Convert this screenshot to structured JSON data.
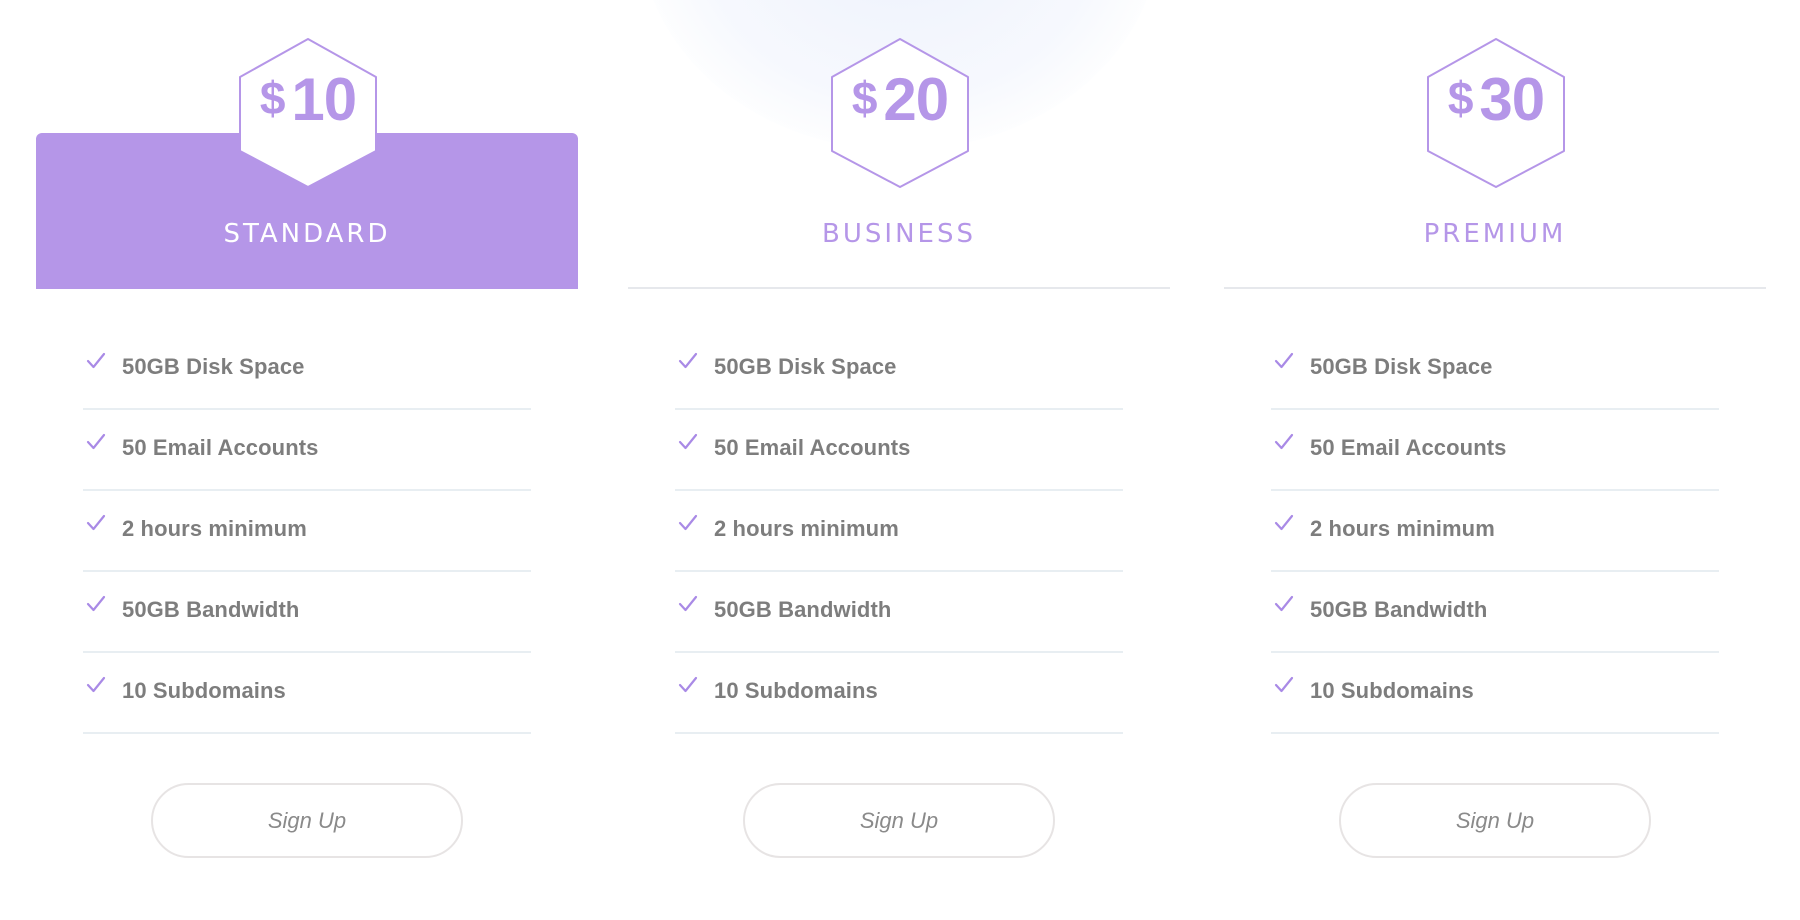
{
  "colors": {
    "accent": "#b596e8",
    "feature_text": "#7d7d7d",
    "divider": "#e8eef2",
    "button_border": "#e7e4e4"
  },
  "plans": [
    {
      "id": "standard",
      "featured": true,
      "currency": "$",
      "amount": "10",
      "name": "STANDARD",
      "features": [
        {
          "icon": "check-icon",
          "label": "50GB Disk Space"
        },
        {
          "icon": "check-icon",
          "label": "50 Email Accounts"
        },
        {
          "icon": "check-icon",
          "label": "2 hours minimum"
        },
        {
          "icon": "check-icon",
          "label": "50GB Bandwidth"
        },
        {
          "icon": "check-icon",
          "label": "10 Subdomains"
        }
      ],
      "button_label": "Sign Up"
    },
    {
      "id": "business",
      "featured": false,
      "currency": "$",
      "amount": "20",
      "name": "BUSINESS",
      "features": [
        {
          "icon": "check-icon",
          "label": "50GB Disk Space"
        },
        {
          "icon": "check-icon",
          "label": "50 Email Accounts"
        },
        {
          "icon": "check-icon",
          "label": "2 hours minimum"
        },
        {
          "icon": "check-icon",
          "label": "50GB Bandwidth"
        },
        {
          "icon": "check-icon",
          "label": "10 Subdomains"
        }
      ],
      "button_label": "Sign Up"
    },
    {
      "id": "premium",
      "featured": false,
      "currency": "$",
      "amount": "30",
      "name": "PREMIUM",
      "features": [
        {
          "icon": "check-icon",
          "label": "50GB Disk Space"
        },
        {
          "icon": "check-icon",
          "label": "50 Email Accounts"
        },
        {
          "icon": "check-icon",
          "label": "2 hours minimum"
        },
        {
          "icon": "check-icon",
          "label": "50GB Bandwidth"
        },
        {
          "icon": "check-icon",
          "label": "10 Subdomains"
        }
      ],
      "button_label": "Sign Up"
    }
  ]
}
